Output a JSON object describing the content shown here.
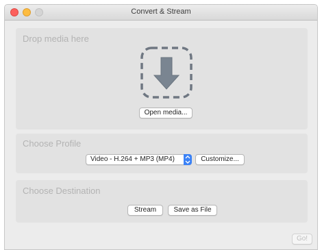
{
  "window": {
    "title": "Convert & Stream"
  },
  "drop_panel": {
    "label": "Drop media here",
    "open_button": "Open media..."
  },
  "profile_panel": {
    "label": "Choose Profile",
    "selected_profile": "Video - H.264 + MP3 (MP4)",
    "customize_button": "Customize..."
  },
  "destination_panel": {
    "label": "Choose Destination",
    "stream_button": "Stream",
    "save_button": "Save as File"
  },
  "footer": {
    "go_button": "Go!"
  },
  "icons": {
    "window_close": "close-traffic-light",
    "window_minimize": "minimize-traffic-light",
    "window_zoom": "zoom-traffic-light",
    "drop_target": "download-arrow-icon",
    "dropdown": "chevron-updown-icon"
  },
  "colors": {
    "accent": "#3b82f6",
    "close": "#fc605c",
    "minimize": "#fdbc40",
    "zoom": "#d5d5d5"
  }
}
